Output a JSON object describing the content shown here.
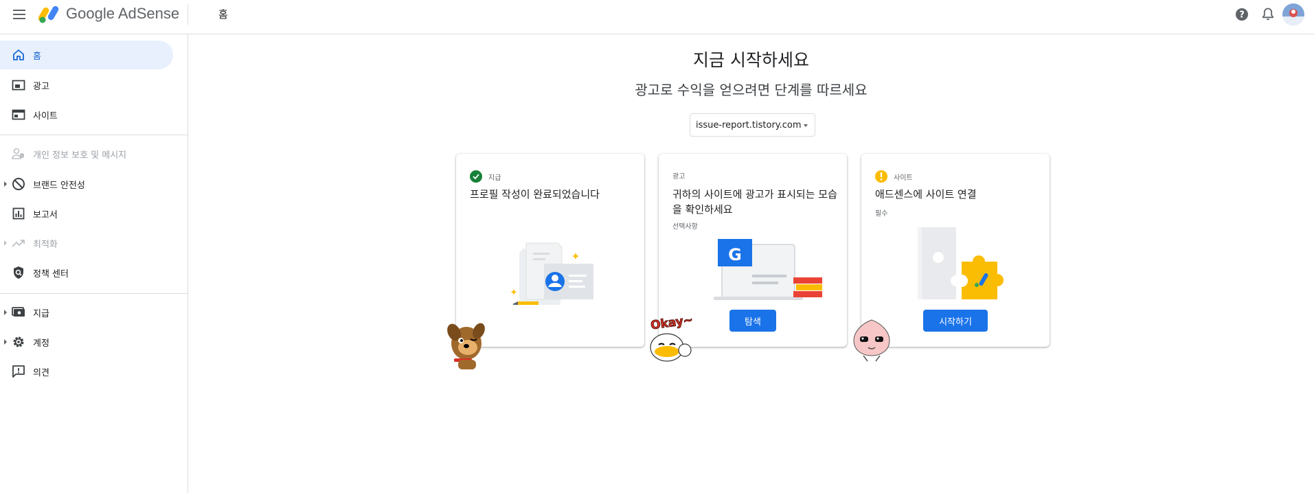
{
  "header": {
    "brand": "Google AdSense",
    "page_crumb": "홈"
  },
  "sidebar": {
    "items": [
      {
        "label": "홈",
        "icon": "home-icon"
      },
      {
        "label": "광고",
        "icon": "ads-icon"
      },
      {
        "label": "사이트",
        "icon": "sites-icon"
      },
      {
        "label": "개인 정보 보호 및 메시지",
        "icon": "privacy-icon"
      },
      {
        "label": "브랜드 안전성",
        "icon": "block-icon"
      },
      {
        "label": "보고서",
        "icon": "reports-icon"
      },
      {
        "label": "최적화",
        "icon": "trending-icon"
      },
      {
        "label": "정책 센터",
        "icon": "policy-shield-icon"
      },
      {
        "label": "지급",
        "icon": "payments-icon"
      },
      {
        "label": "계정",
        "icon": "gear-icon"
      },
      {
        "label": "의견",
        "icon": "feedback-icon"
      }
    ]
  },
  "main": {
    "title": "지금 시작하세요",
    "subtitle": "광고로 수익을 얻으려면 단계를 따르세요",
    "site_selector": "issue-report.tistory.com",
    "cards": [
      {
        "status": "지급",
        "title": "프로필 작성이 완료되었습니다",
        "note": "",
        "button": ""
      },
      {
        "status": "광고",
        "title": "귀하의 사이트에 광고가 표시되는 모습을 확인하세요",
        "note": "선택사항",
        "button": "탐색"
      },
      {
        "status": "사이트",
        "title": "애드센스에 사이트 연결",
        "note": "필수",
        "button": "시작하기"
      }
    ]
  },
  "colors": {
    "accent": "#1a73e8",
    "active_nav_bg": "#e8f0fe",
    "success": "#188038",
    "warning": "#fbbc04"
  },
  "stickers": {
    "okay_text": "Okay~"
  }
}
